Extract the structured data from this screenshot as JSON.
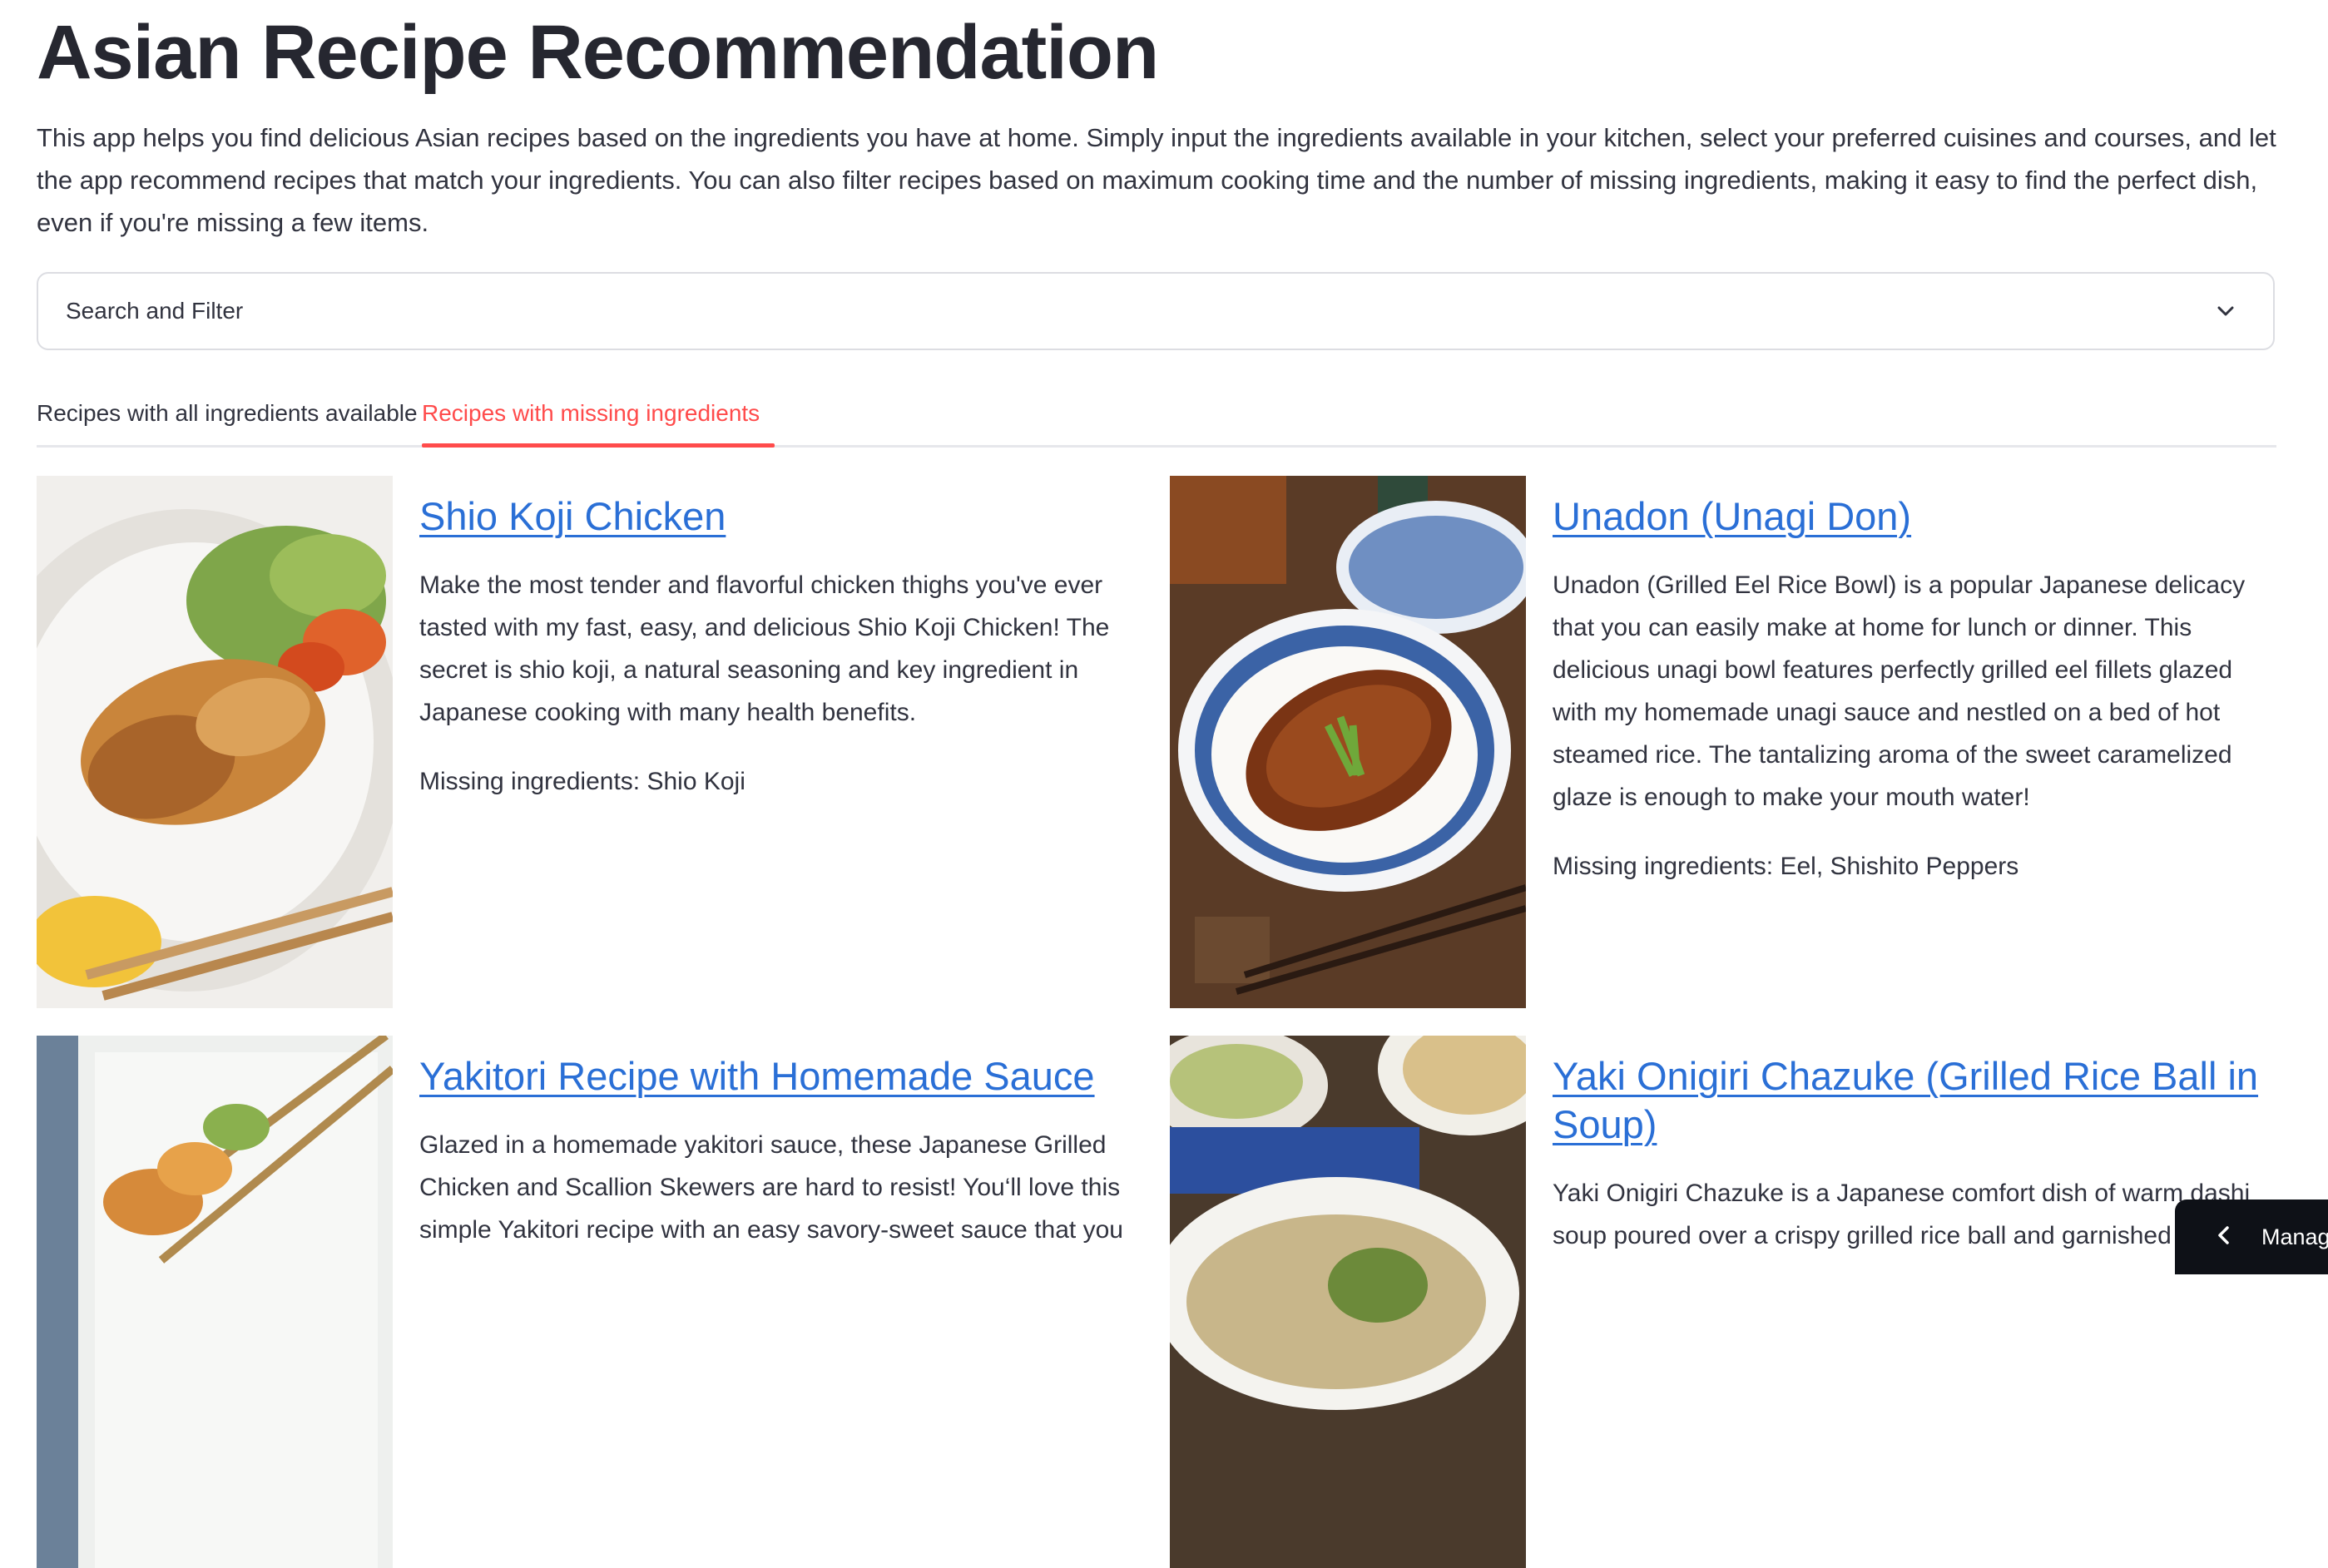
{
  "title": "Asian Recipe Recommendation",
  "intro": "This app helps you find delicious Asian recipes based on the ingredients you have at home. Simply input the ingredients available in your kitchen, select your preferred cuisines and courses, and let the app recommend recipes that match your ingredients. You can also filter recipes based on maximum cooking time and the number of missing ingredients, making it easy to find the perfect dish, even if you're missing a few items.",
  "expander": {
    "label": "Search and Filter",
    "icon": "chevron-down-icon"
  },
  "tabs": [
    {
      "label": "Recipes with all ingredients available",
      "active": false
    },
    {
      "label": "Recipes with missing ingredients",
      "active": true
    }
  ],
  "recipes": [
    {
      "title": "Shio Koji Chicken",
      "description": "Make the most tender and flavorful chicken thighs you've ever tasted with my fast, easy, and delicious Shio Koji Chicken! The secret is shio koji, a natural seasoning and key ingredient in Japanese cooking with many health benefits.",
      "missing": "Missing ingredients: Shio Koji"
    },
    {
      "title": "Unadon (Unagi Don)",
      "description": "Unadon (Grilled Eel Rice Bowl) is a popular Japanese delicacy that you can easily make at home for lunch or dinner. This delicious unagi bowl features perfectly grilled eel fillets glazed with my homemade unagi sauce and nestled on a bed of hot steamed rice. The tantalizing aroma of the sweet caramelized glaze is enough to make your mouth water!",
      "missing": "Missing ingredients: Eel, Shishito Peppers"
    },
    {
      "title": "Yakitori Recipe with Homemade Sauce",
      "description": "Glazed in a homemade yakitori sauce, these Japanese Grilled Chicken and Scallion Skewers are hard to resist! You‘ll love this simple Yakitori recipe with an easy savory-sweet sauce that you",
      "missing": ""
    },
    {
      "title": "Yaki Onigiri Chazuke (Grilled Rice Ball in Soup)",
      "description": "Yaki Onigiri Chazuke is a Japanese comfort dish of warm dashi soup poured over a crispy grilled rice ball and garnished",
      "missing": ""
    }
  ],
  "manage": {
    "label": "Manage app",
    "icon": "chevron-left-icon"
  },
  "colors": {
    "accent": "#ff4b4b",
    "link": "#2a6fd6",
    "text": "#31333f"
  }
}
